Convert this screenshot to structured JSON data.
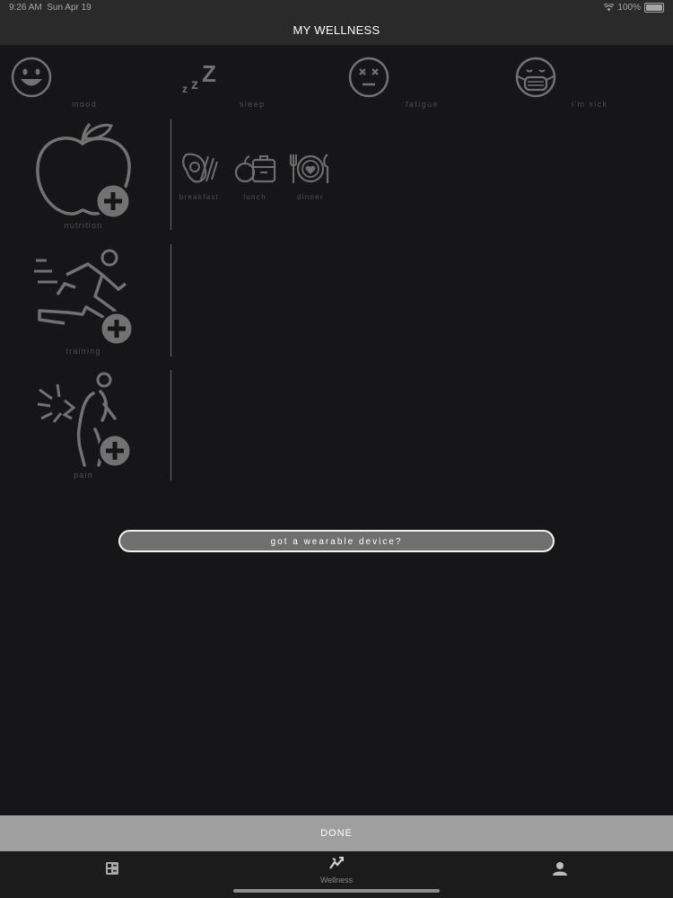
{
  "status": {
    "time": "9:26 AM",
    "date": "Sun Apr 19",
    "battery": "100%"
  },
  "header": {
    "title": "MY WELLNESS"
  },
  "quick_logs": [
    {
      "label": "mood",
      "icon": "smile-face-icon"
    },
    {
      "label": "sleep",
      "icon": "zzz-icon"
    },
    {
      "label": "fatigue",
      "icon": "dizzy-face-icon"
    },
    {
      "label": "i'm sick",
      "icon": "mask-face-icon"
    }
  ],
  "sections": {
    "nutrition": {
      "label": "nutrition",
      "meals": [
        {
          "label": "breakfast"
        },
        {
          "label": "lunch"
        },
        {
          "label": "dinner"
        }
      ]
    },
    "training": {
      "label": "training"
    },
    "pain": {
      "label": "pain"
    }
  },
  "wearable": {
    "label": "got a wearable device?"
  },
  "done": {
    "label": "DONE"
  },
  "tabs": [
    {
      "label": ""
    },
    {
      "label": "Wellness"
    },
    {
      "label": ""
    }
  ],
  "colors": {
    "background": "#161517",
    "icon_gray": "#707070",
    "button_gray": "#6f6f6d",
    "done_bar": "#a09fa0"
  }
}
